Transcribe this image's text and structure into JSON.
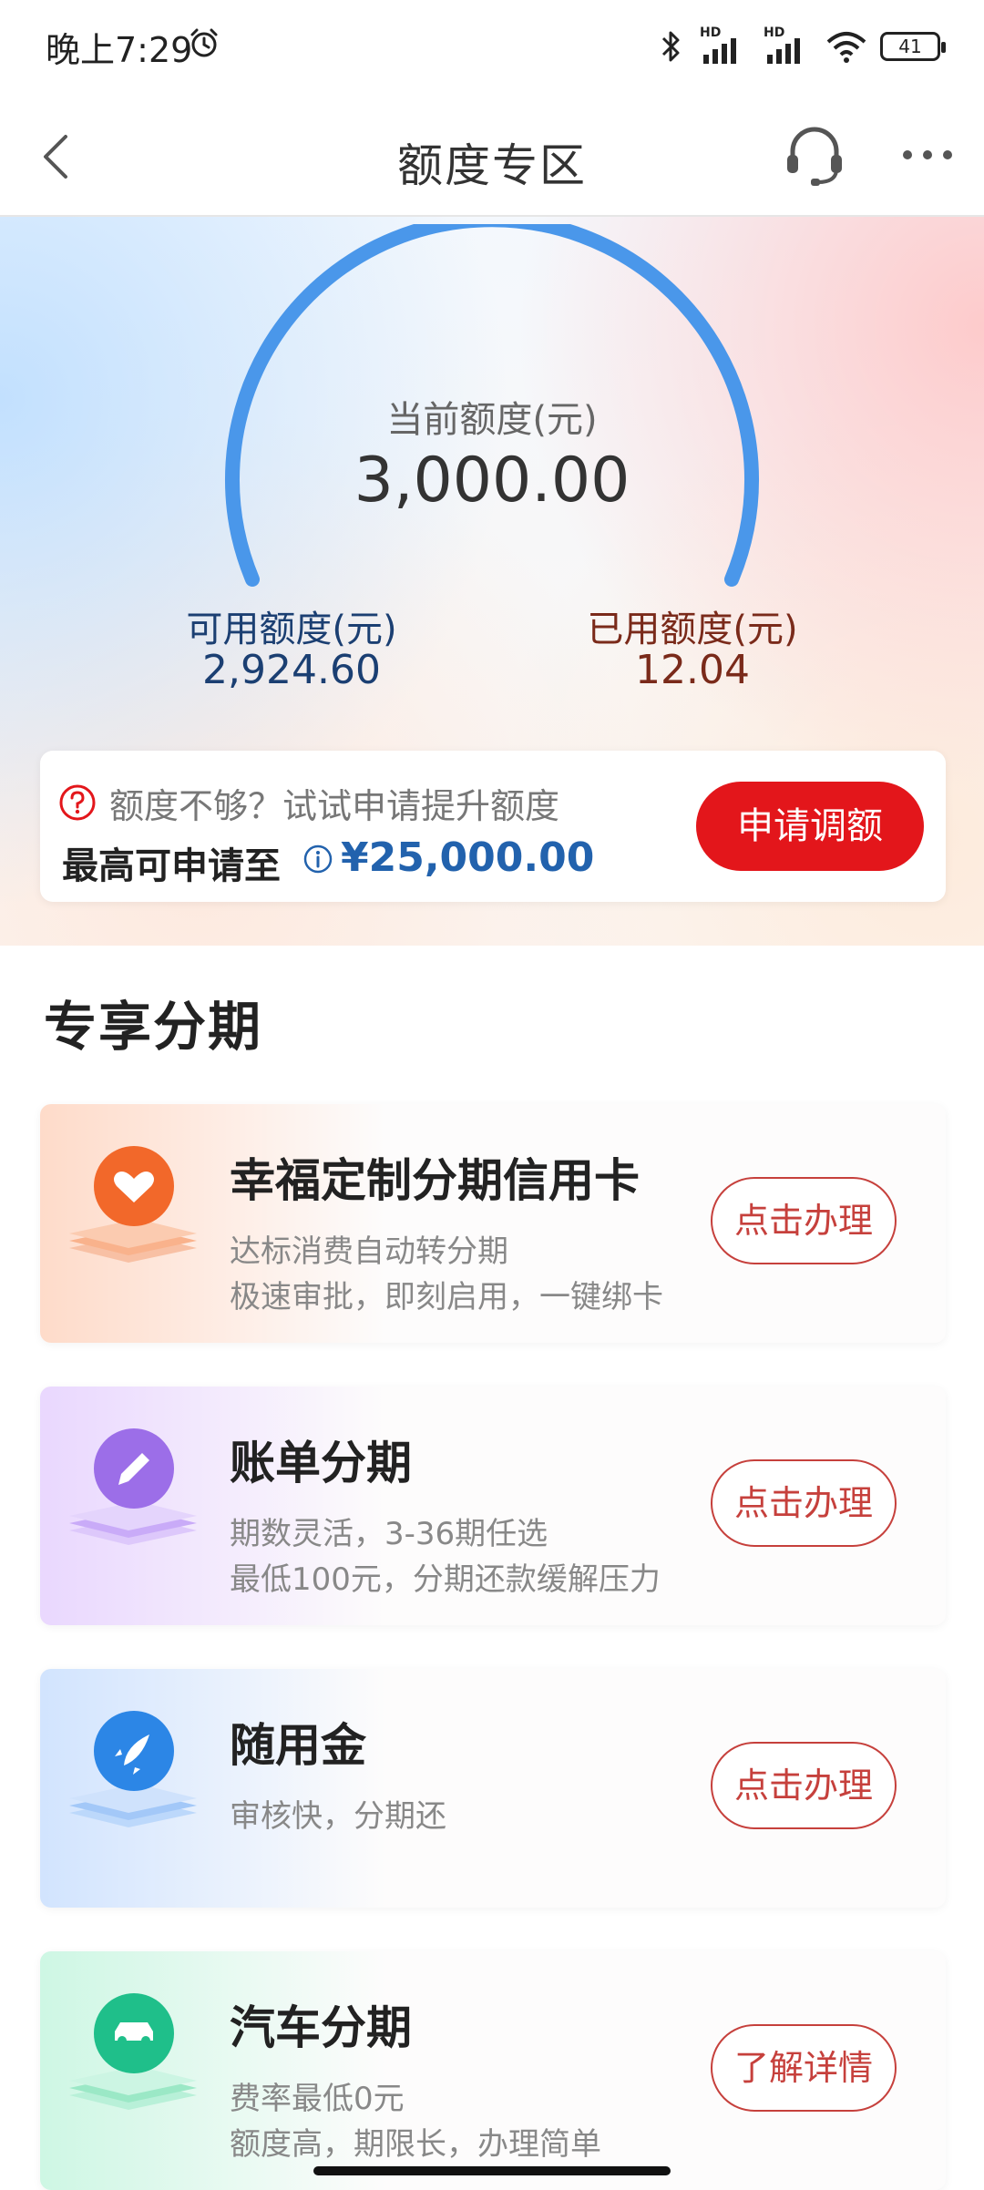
{
  "status_bar": {
    "time": "晚上7:29",
    "battery": "41",
    "signal_tag": "HD"
  },
  "nav": {
    "title": "额度专区"
  },
  "gauge": {
    "current_label": "当前额度(元)",
    "current_value": "3,000.00",
    "used_fraction": 0.004,
    "arc_color": "#4a97ea",
    "used_color": "#e5463a"
  },
  "available": {
    "label": "可用额度(元)",
    "value": "2,924.60"
  },
  "used": {
    "label": "已用额度(元)",
    "value": "12.04"
  },
  "limit_card": {
    "tip": "额度不够？试试申请提升额度",
    "max_label": "最高可申请至",
    "max_value": "¥25,000.00",
    "apply_button": "申请调额"
  },
  "section": {
    "title": "专享分期"
  },
  "products": [
    {
      "title": "幸福定制分期信用卡",
      "desc1": "达标消费自动转分期",
      "desc2": "极速审批，即刻启用，一键绑卡",
      "button": "点击办理",
      "icon": "heart-icon",
      "color": "#f2682a"
    },
    {
      "title": "账单分期",
      "desc1": "期数灵活，3-36期任选",
      "desc2": "最低100元，分期还款缓解压力",
      "button": "点击办理",
      "icon": "pencil-icon",
      "color": "#9c6ee8"
    },
    {
      "title": "随用金",
      "desc1": "审核快，分期还",
      "desc2": "",
      "button": "点击办理",
      "icon": "rocket-icon",
      "color": "#2c86e6"
    },
    {
      "title": "汽车分期",
      "desc1": "费率最低0元",
      "desc2": "额度高，期限长，办理简单",
      "button": "了解详情",
      "icon": "car-icon",
      "color": "#1fbf8a"
    }
  ]
}
